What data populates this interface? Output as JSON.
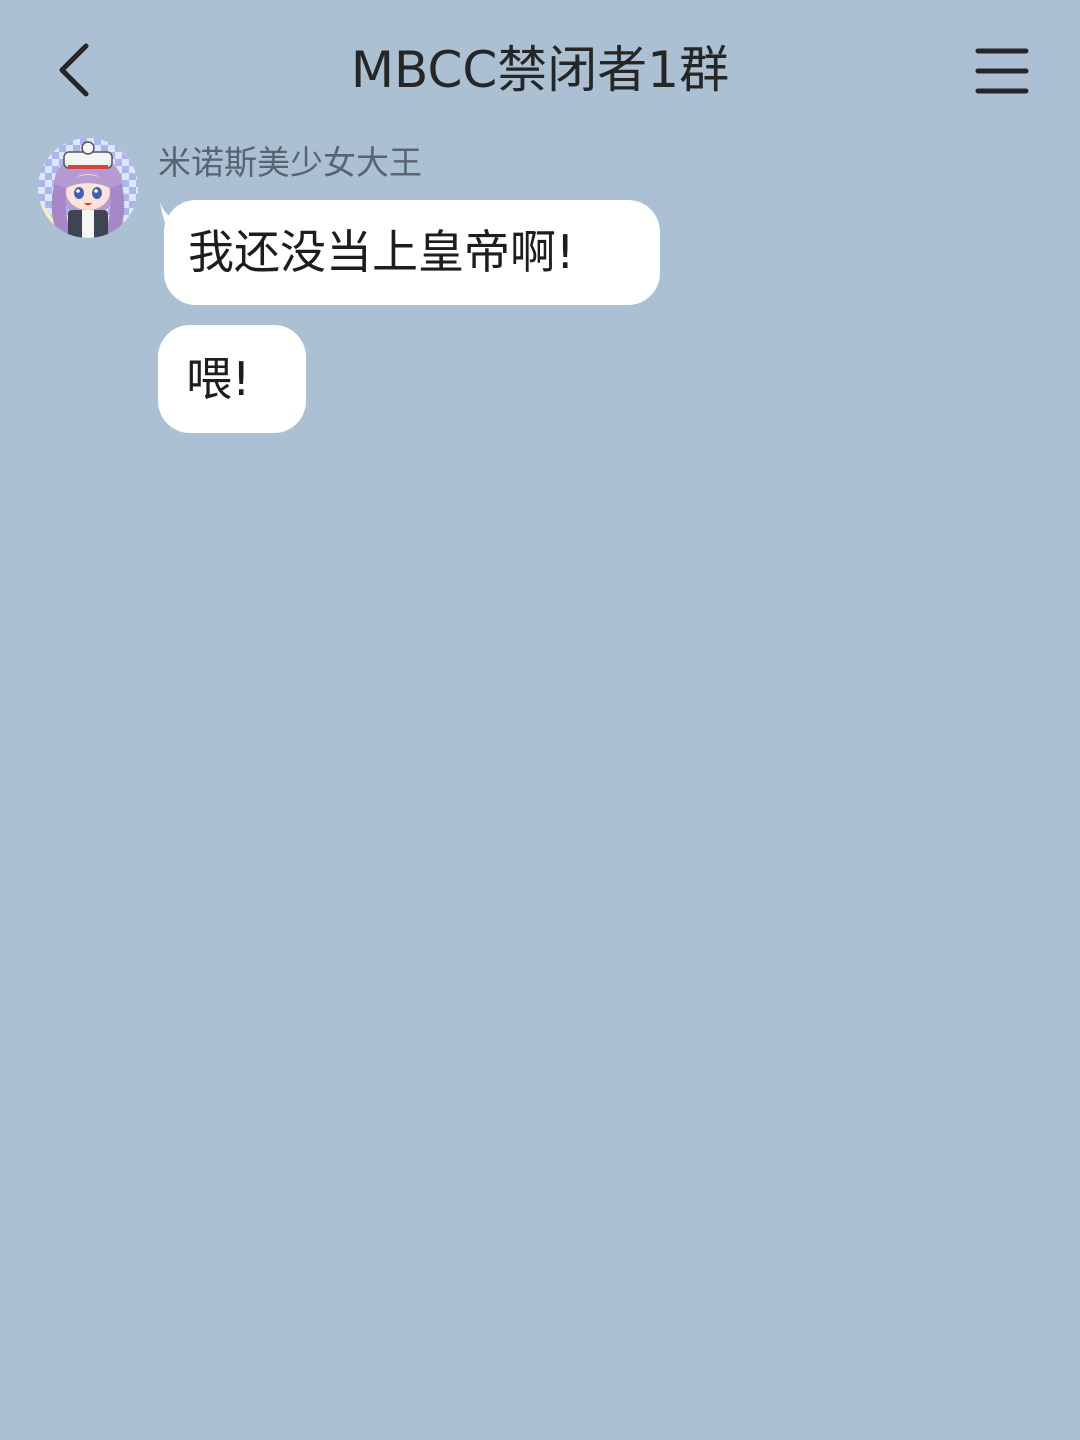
{
  "header": {
    "title": "MBCC禁闭者1群",
    "back_icon": "chevron-left-icon",
    "menu_icon": "hamburger-menu-icon"
  },
  "messages": [
    {
      "sender": "米诺斯美少女大王",
      "avatar_icon": "anime-girl-avatar",
      "texts": [
        "我还没当上皇帝啊!",
        "喂!"
      ]
    }
  ],
  "colors": {
    "background": "#abc0d3",
    "bubble": "#ffffff",
    "title_text": "#262626",
    "sender_text": "#5a6470",
    "message_text": "#1d1d1d"
  }
}
